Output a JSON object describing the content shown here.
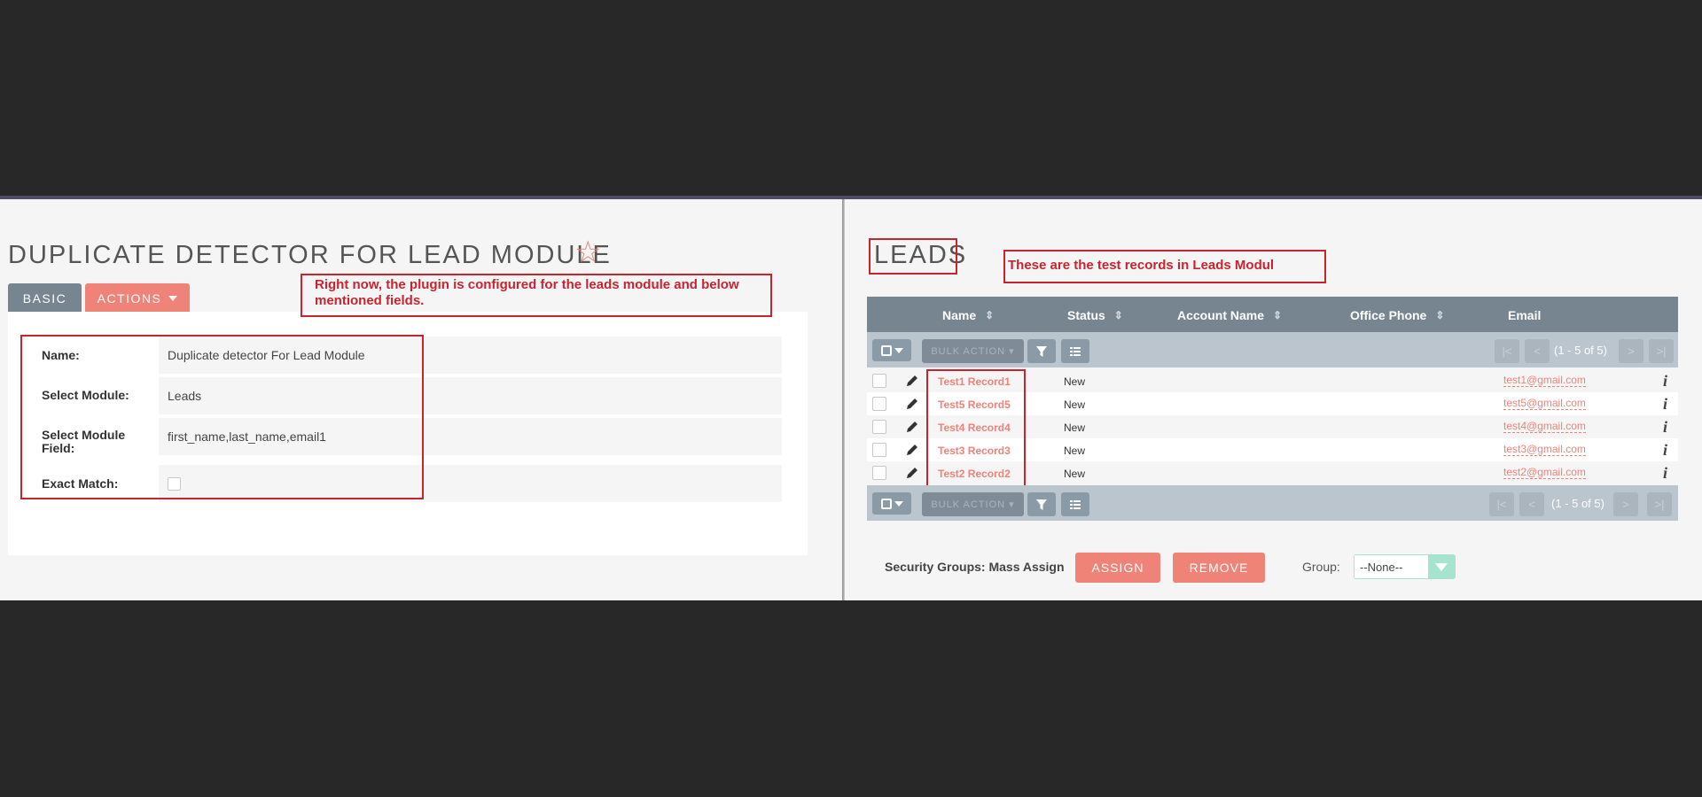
{
  "left": {
    "title": "DUPLICATE DETECTOR FOR LEAD MODULE",
    "tabs": {
      "basic": "BASIC",
      "actions": "ACTIONS"
    },
    "fields": [
      {
        "label": "Name:",
        "value": "Duplicate detector For Lead Module"
      },
      {
        "label": "Select Module:",
        "value": "Leads"
      },
      {
        "label": "Select Module Field:",
        "value": "first_name,last_name,email1"
      },
      {
        "label": "Exact Match:",
        "value": ""
      }
    ],
    "annotation": "Right now, the plugin is configured for the leads module and below mentioned fields."
  },
  "right": {
    "title": "LEADS",
    "annotation": "These are the test records in Leads Modul",
    "columns": [
      "Name",
      "Status",
      "Account Name",
      "Office Phone",
      "Email"
    ],
    "bulk_action": "BULK ACTION",
    "pagination": "(1 - 5 of 5)",
    "rows": [
      {
        "name": "Test1 Record1",
        "status": "New",
        "email": "test1@gmail.com"
      },
      {
        "name": "Test5 Record5",
        "status": "New",
        "email": "test5@gmail.com"
      },
      {
        "name": "Test4 Record4",
        "status": "New",
        "email": "test4@gmail.com"
      },
      {
        "name": "Test3 Record3",
        "status": "New",
        "email": "test3@gmail.com"
      },
      {
        "name": "Test2 Record2",
        "status": "New",
        "email": "test2@gmail.com"
      }
    ],
    "info_glyph": "i",
    "security": {
      "label": "Security Groups: Mass Assign",
      "assign": "ASSIGN",
      "remove": "REMOVE",
      "group_label": "Group:",
      "group_value": "--None--"
    }
  },
  "colors": {
    "accent": "#f08377",
    "header": "#778591",
    "annotation": "#c8242d",
    "toolbar": "#bac5ce"
  }
}
